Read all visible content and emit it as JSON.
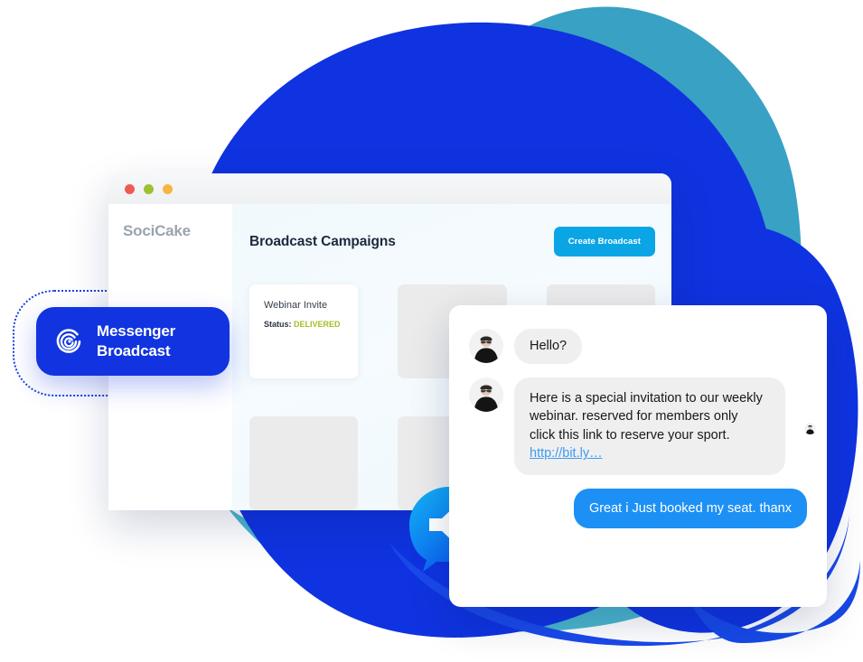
{
  "colors": {
    "brand_blue": "#1134e0",
    "accent_cyan": "#09a5e5",
    "bubble_out_blue": "#1d90f5",
    "bubble_in_gray": "#efeff0",
    "status_green": "#a7bd26",
    "link_blue": "#3e9cf0",
    "blob_blue": "#0f33e0",
    "blob_teal": "#2e9cc0",
    "blob_steel": "#2e7fc0",
    "blob_purple": "#5b4a93",
    "traffic_red": "#f05a52",
    "traffic_green": "#9fc130",
    "traffic_orange": "#f5b63f"
  },
  "badge": {
    "icon": "spiral-broadcast-icon",
    "line1": "Messenger",
    "line2": "Broadcast"
  },
  "browser": {
    "traffic_lights": [
      {
        "name": "close",
        "color": "#f05a52"
      },
      {
        "name": "minimize",
        "color": "#9fc130"
      },
      {
        "name": "maximize",
        "color": "#f5b63f"
      }
    ],
    "sidebar": {
      "brand": "SociCake"
    },
    "main": {
      "title": "Broadcast Campaigns",
      "create_button": "Create Broadcast",
      "cards": [
        {
          "type": "filled",
          "name": "Webinar Invite",
          "status_label": "Status:",
          "status_value": "DELIVERED"
        },
        {
          "type": "ghost"
        },
        {
          "type": "ghost"
        },
        {
          "type": "ghost"
        },
        {
          "type": "ghost"
        },
        {
          "type": "ghost"
        }
      ]
    }
  },
  "speaker": {
    "icon": "speaker-broadcast-bubble-icon"
  },
  "chat": {
    "messages": [
      {
        "side": "in",
        "avatar": "contact-avatar",
        "text": "Hello?"
      },
      {
        "side": "in",
        "avatar": "contact-avatar",
        "text": "Here is a special invitation to our weekly webinar. reserved for members only\nclick this link to reserve your sport. ",
        "link": "http://bit.ly…"
      },
      {
        "side": "out",
        "text": "Great i Just booked my seat. thanx"
      }
    ],
    "side_avatar": "small-contact-avatar"
  }
}
